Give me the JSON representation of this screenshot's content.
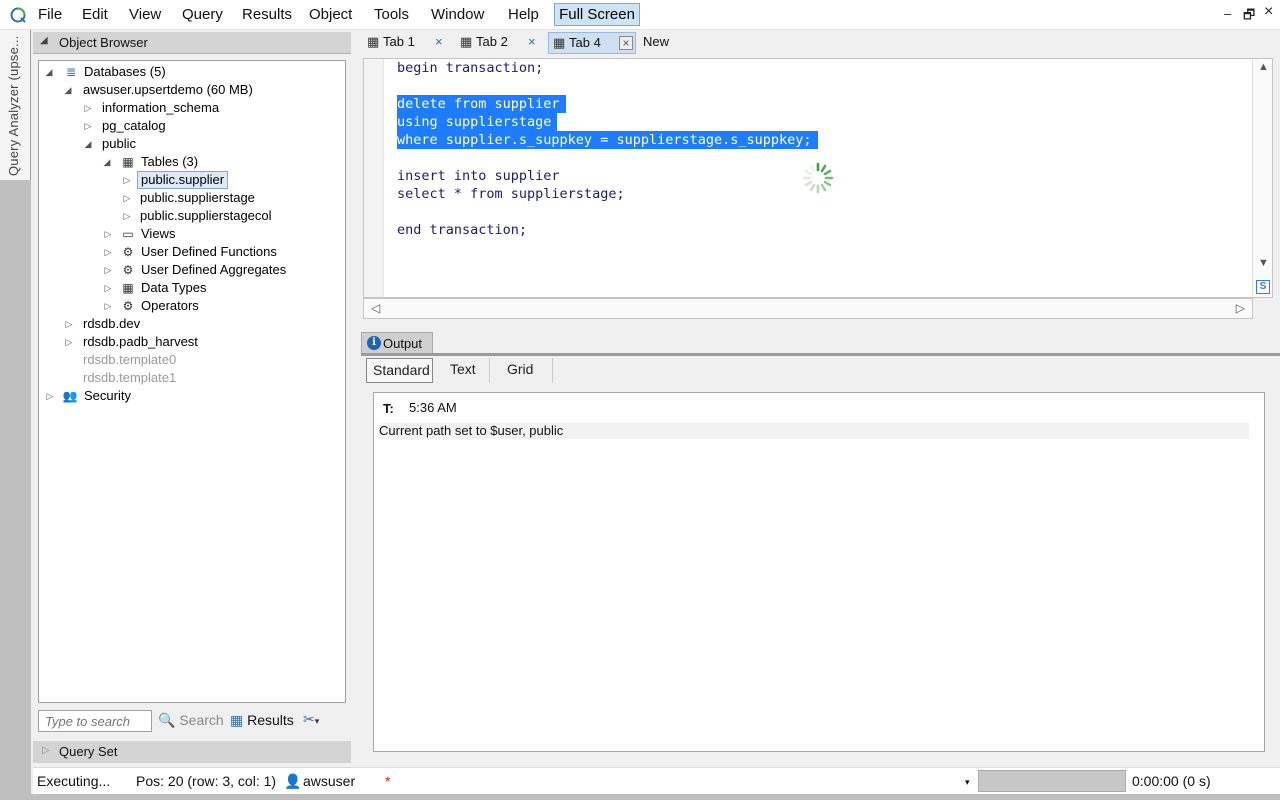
{
  "menu": {
    "items": [
      "File",
      "Edit",
      "View",
      "Query",
      "Results",
      "Object",
      "Tools",
      "Window",
      "Help"
    ],
    "fullscreen_label": "Full Screen",
    "window_controls": {
      "minimize": "–",
      "restore": "🗗",
      "close": "×"
    }
  },
  "side_tab": {
    "label": "Query Analyzer (upse..."
  },
  "object_browser": {
    "title": "Object Browser",
    "tree": {
      "databases": "Databases (5)",
      "db_upsert": "awsuser.upsertdemo (60 MB)",
      "information_schema": "information_schema",
      "pg_catalog": "pg_catalog",
      "public": "public",
      "tables": "Tables (3)",
      "table_supplier": "public.supplier",
      "table_supplierstage": "public.supplierstage",
      "table_supplierstagecol": "public.supplierstagecol",
      "views": "Views",
      "udf": "User Defined Functions",
      "uda": "User Defined Aggregates",
      "data_types": "Data Types",
      "operators": "Operators",
      "rdsdb_dev": "rdsdb.dev",
      "rdsdb_padb_harvest": "rdsdb.padb_harvest",
      "rdsdb_template0": "rdsdb.template0",
      "rdsdb_template1": "rdsdb.template1",
      "security": "Security"
    },
    "search_placeholder": "Type to search",
    "search_label": "Search",
    "results_label": "Results"
  },
  "query_set": {
    "title": "Query Set"
  },
  "tabs": [
    {
      "label": "Tab 1"
    },
    {
      "label": "Tab 2"
    },
    {
      "label": "Tab 4"
    },
    {
      "label": "New"
    }
  ],
  "editor": {
    "lines": [
      "begin transaction;",
      "",
      "delete from supplier",
      "using supplierstage",
      "where supplier.s_suppkey = supplierstage.s_suppkey;",
      "",
      "insert into supplier",
      "select * from supplierstage;",
      "",
      "end transaction;"
    ]
  },
  "output": {
    "tab_label": "Output",
    "subtabs": [
      "Standard",
      "Text",
      "Grid"
    ],
    "t_label": "T:",
    "time": "5:36 AM",
    "message": "Current path set to $user, public"
  },
  "status": {
    "state": "Executing...",
    "position": "Pos: 20 (row: 3, col: 1)",
    "user": "awsuser",
    "modified": "*",
    "elapsed": "0:00:00 (0 s)"
  },
  "colors": {
    "selection": "#1e7cff",
    "code": "#1b1b78",
    "accent": "#cde4f7"
  }
}
